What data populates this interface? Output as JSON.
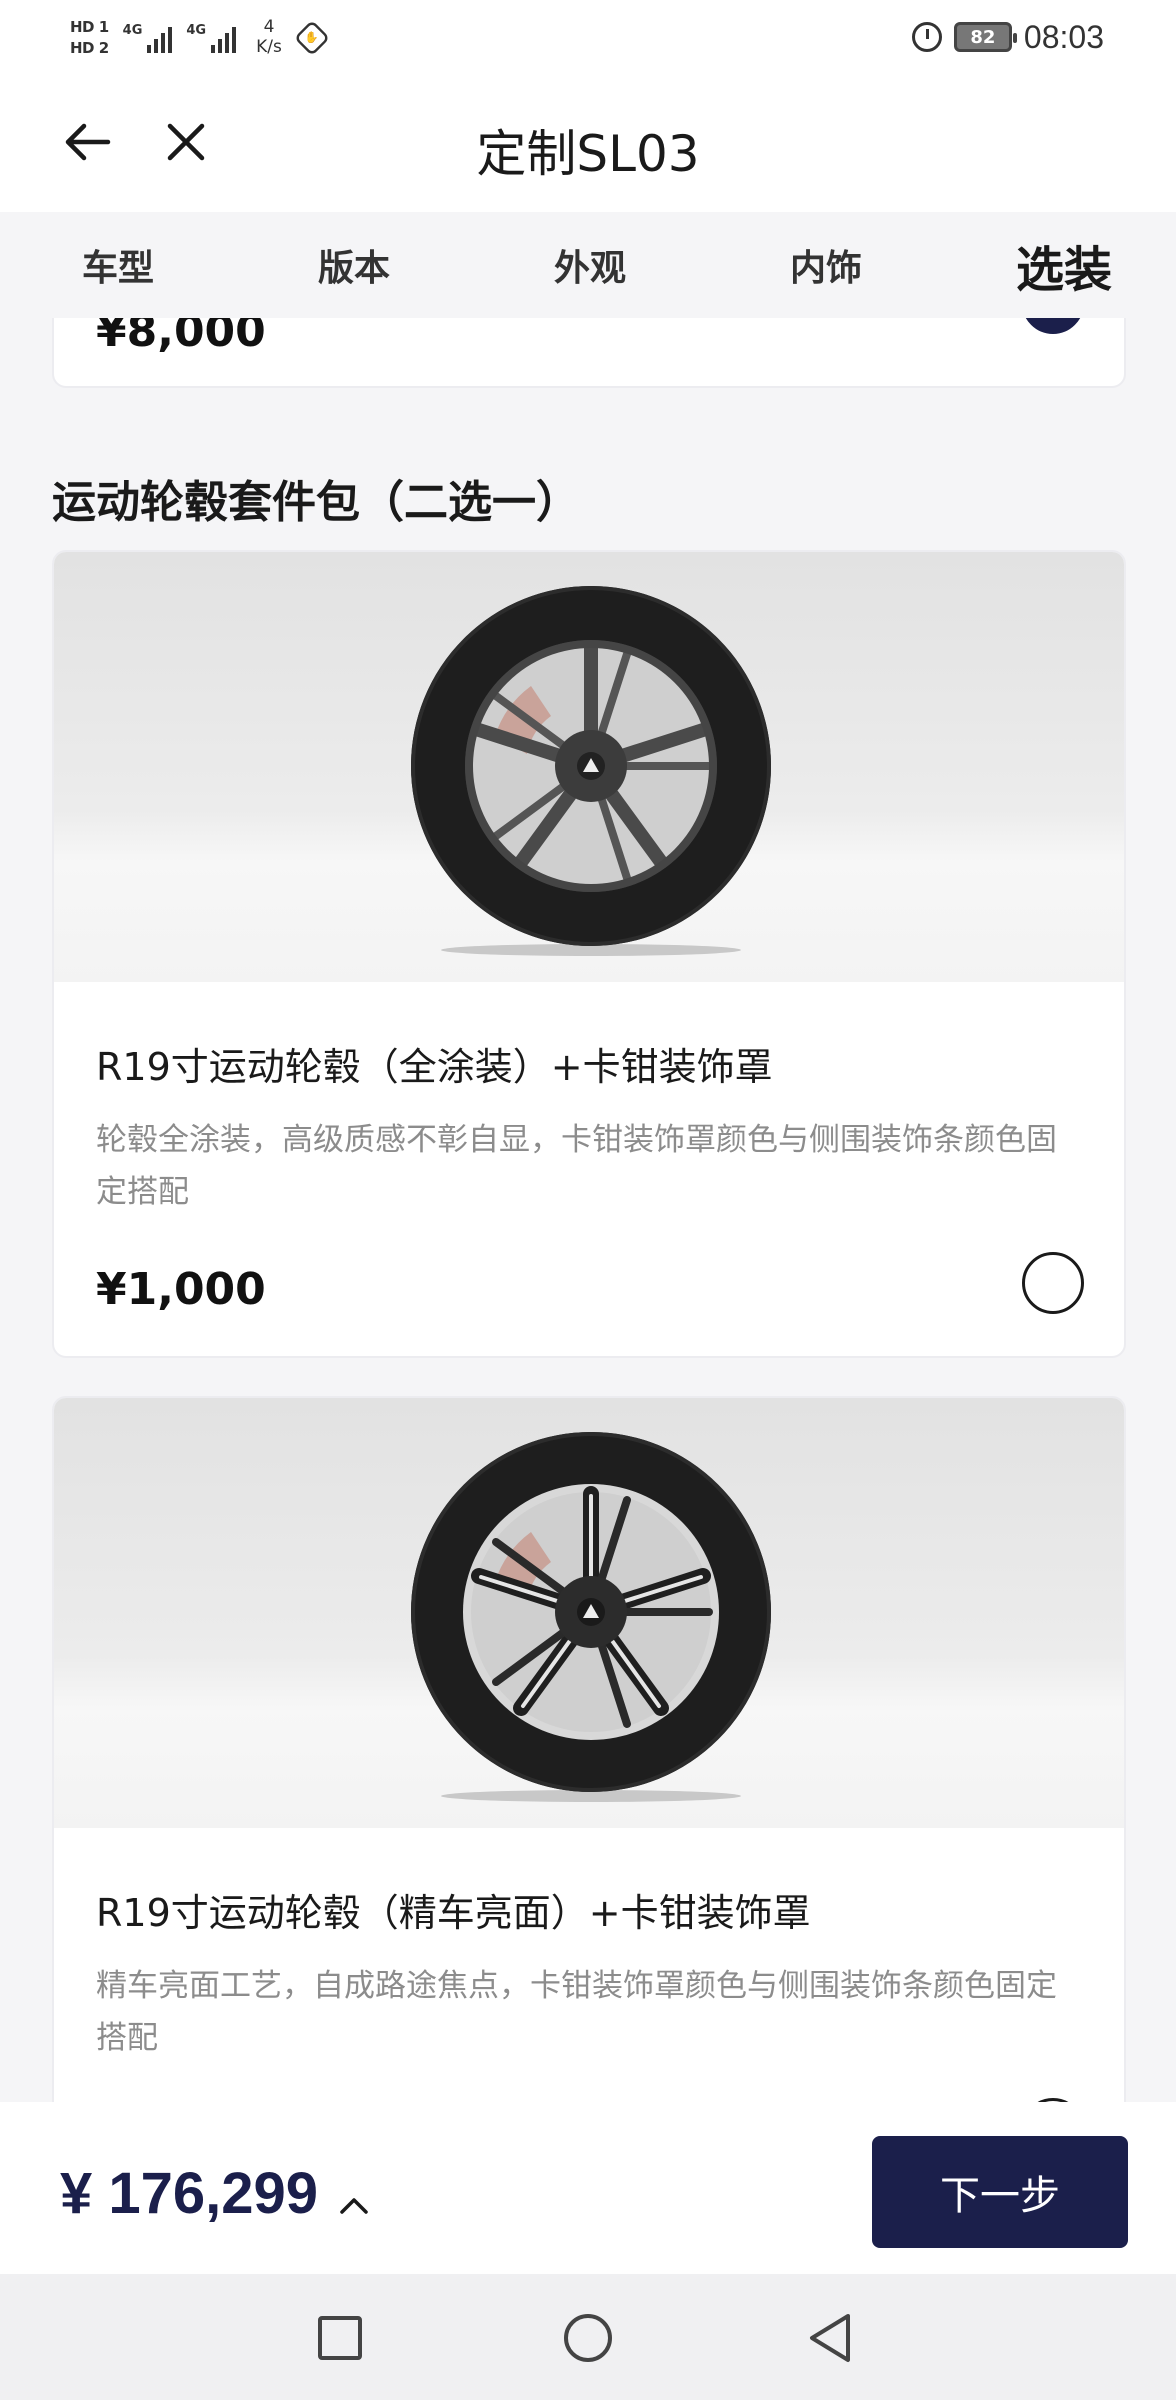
{
  "status_bar": {
    "sim1": "HD 1",
    "sim2": "HD 2",
    "network1": "4G",
    "network2": "4G",
    "speed_value": "4",
    "speed_unit": "K/s",
    "battery": "82",
    "time": "08:03"
  },
  "header": {
    "title": "定制SL03",
    "back_icon": "arrow-left-icon",
    "close_icon": "close-icon"
  },
  "tabs": [
    {
      "label": "车型",
      "active": false
    },
    {
      "label": "版本",
      "active": false
    },
    {
      "label": "外观",
      "active": false
    },
    {
      "label": "内饰",
      "active": false
    },
    {
      "label": "选装",
      "active": true
    }
  ],
  "previous_option": {
    "price": "¥8,000",
    "selected": true
  },
  "section": {
    "title": "运动轮毂套件包（二选一）"
  },
  "options": [
    {
      "name": "R19寸运动轮毂（全涂装）+卡钳装饰罩",
      "description": "轮毂全涂装，高级质感不彰自显，卡钳装饰罩颜色与侧围装饰条颜色固定搭配",
      "price": "¥1,000",
      "selected": false
    },
    {
      "name": "R19寸运动轮毂（精车亮面）+卡钳装饰罩",
      "description": "精车亮面工艺，自成路途焦点，卡钳装饰罩颜色与侧围装饰条颜色固定搭配",
      "price": "",
      "selected": false
    }
  ],
  "bottom_bar": {
    "total_price": "¥ 176,299",
    "next_label": "下一步"
  },
  "colors": {
    "brand_navy": "#1b1f4b",
    "background": "#f5f5f7"
  }
}
